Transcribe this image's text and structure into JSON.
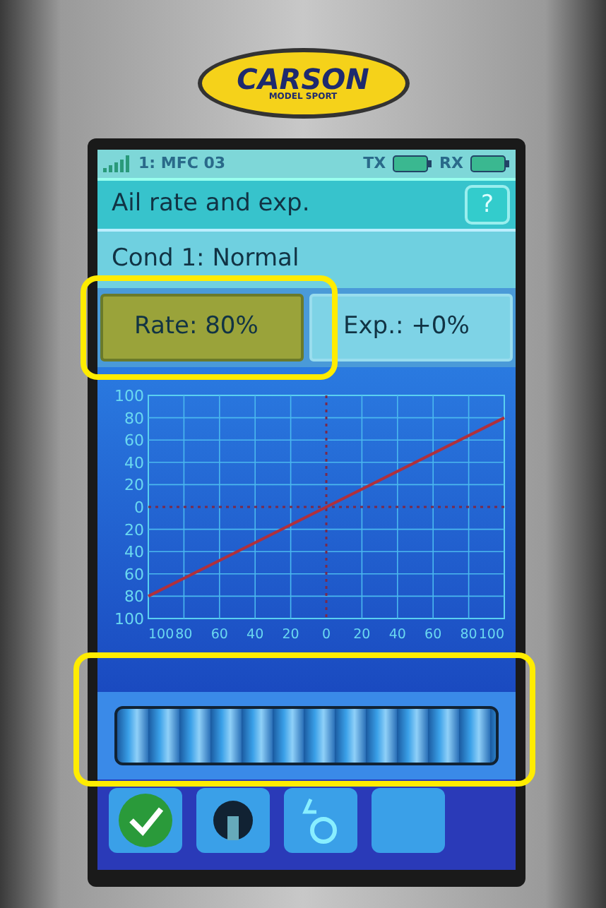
{
  "device": {
    "logo": "CARSON",
    "logo_subtitle": "MODEL SPORT"
  },
  "status_bar": {
    "model": "1: MFC 03",
    "tx_label": "TX",
    "rx_label": "RX"
  },
  "title": "Ail rate and exp.",
  "help_button": "?",
  "condition": "Cond 1: Normal",
  "fields": [
    {
      "label": "Rate: 80%",
      "selected": true
    },
    {
      "label": "Exp.: +0%",
      "selected": false
    }
  ],
  "chart": {
    "chart_data": {
      "type": "line",
      "x": [
        -100,
        100
      ],
      "series": [
        {
          "color": "#b0303c",
          "values": [
            -80,
            80
          ]
        }
      ],
      "xlim": [
        -100,
        100
      ],
      "ylim": [
        -100,
        100
      ],
      "grid": true,
      "xticks": [
        {
          "value": -100,
          "label": "100"
        },
        {
          "value": -80,
          "label": "80"
        },
        {
          "value": -60,
          "label": "60"
        },
        {
          "value": -40,
          "label": "40"
        },
        {
          "value": -20,
          "label": "20"
        },
        {
          "value": 0,
          "label": "0"
        },
        {
          "value": 20,
          "label": "20"
        },
        {
          "value": 40,
          "label": "40"
        },
        {
          "value": 60,
          "label": "60"
        },
        {
          "value": 80,
          "label": "80"
        },
        {
          "value": 100,
          "label": "100"
        }
      ],
      "yticks": [
        {
          "value": 100,
          "label": "100"
        },
        {
          "value": 80,
          "label": "80"
        },
        {
          "value": 60,
          "label": "60"
        },
        {
          "value": 40,
          "label": "40"
        },
        {
          "value": 20,
          "label": "20"
        },
        {
          "value": 0,
          "label": "0"
        },
        {
          "value": -20,
          "label": "20"
        },
        {
          "value": -40,
          "label": "40"
        },
        {
          "value": -60,
          "label": "60"
        },
        {
          "value": -80,
          "label": "80"
        },
        {
          "value": -100,
          "label": "100"
        }
      ]
    }
  }
}
